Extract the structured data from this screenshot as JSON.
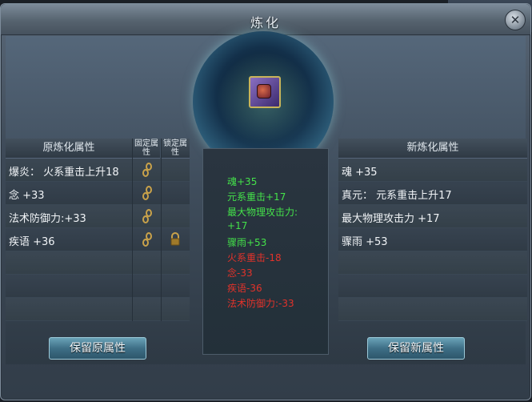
{
  "window": {
    "title": "炼化",
    "close_glyph": "✕"
  },
  "colors": {
    "positive": "#44e24a",
    "negative": "#e2322a",
    "text": "#f0f3f6"
  },
  "left_table": {
    "header": "原炼化属性",
    "fix_header": "固定属性",
    "lock_header": "锁定属性",
    "rows": [
      {
        "text": "爆炎： 火系重击上升18",
        "fixed_icon": "chain-icon",
        "locked": false
      },
      {
        "text": "念 +33",
        "fixed_icon": "chain-icon",
        "locked": false
      },
      {
        "text": "法术防御力:+33",
        "fixed_icon": "chain-icon",
        "locked": false
      },
      {
        "text": "疾语 +36",
        "fixed_icon": "chain-icon",
        "locked": true,
        "lock_icon": "lock-icon"
      },
      {
        "text": ""
      },
      {
        "text": ""
      },
      {
        "text": ""
      }
    ],
    "button": "保留原属性"
  },
  "center_changes": [
    {
      "text": "魂+35",
      "kind": "pos"
    },
    {
      "text": "元系重击+17",
      "kind": "pos"
    },
    {
      "text": "最大物理攻击力:",
      "kind": "pos"
    },
    {
      "text": "+17",
      "kind": "pos"
    },
    {
      "text": "骤雨+53",
      "kind": "pos"
    },
    {
      "text": "火系重击-18",
      "kind": "neg"
    },
    {
      "text": "念-33",
      "kind": "neg"
    },
    {
      "text": "疾语-36",
      "kind": "neg"
    },
    {
      "text": "法术防御力:-33",
      "kind": "neg"
    }
  ],
  "right_table": {
    "header": "新炼化属性",
    "rows": [
      "魂 +35",
      "真元： 元系重击上升17",
      "最大物理攻击力 +17",
      "骤雨 +53",
      "",
      "",
      ""
    ],
    "button": "保留新属性"
  },
  "item": {
    "icon": "refine-item-icon"
  }
}
